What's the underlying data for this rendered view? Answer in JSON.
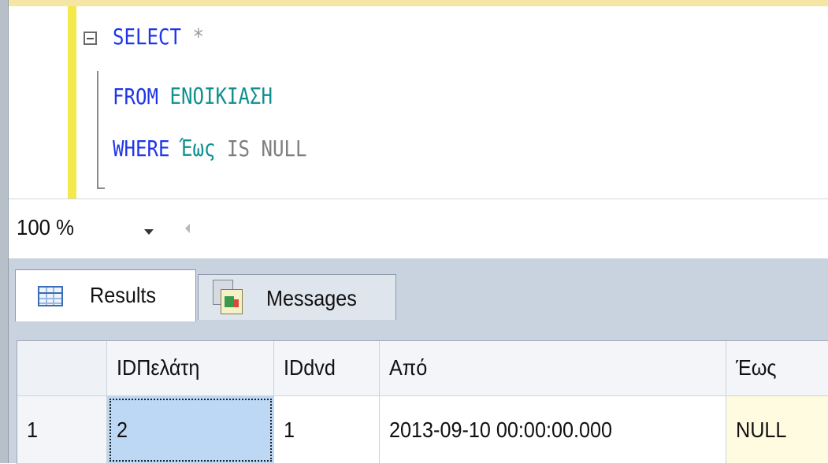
{
  "editor": {
    "lines": [
      {
        "keyword": "SELECT",
        "rest": "*"
      },
      {
        "keyword": "FROM",
        "rest": "ΕΝΟΙΚΙΑΣΗ"
      },
      {
        "keyword": "WHERE",
        "ident": "Έως",
        "rest": "IS NULL"
      }
    ]
  },
  "zoom": {
    "value": "100 %"
  },
  "tabs": [
    {
      "label": "Results",
      "icon": "grid-icon"
    },
    {
      "label": "Messages",
      "icon": "messages-icon"
    }
  ],
  "grid": {
    "columns": [
      "",
      "IDΠελάτη",
      "IDdvd",
      "Από",
      "Έως"
    ],
    "rows": [
      [
        "1",
        "2",
        "1",
        "2013-09-10 00:00:00.000",
        "NULL"
      ]
    ]
  },
  "colors": {
    "keyword": "#1f35e8",
    "identifier": "#0f8f8f",
    "null_cell": "#fffbe0",
    "selected_cell": "#bcd8f5"
  }
}
